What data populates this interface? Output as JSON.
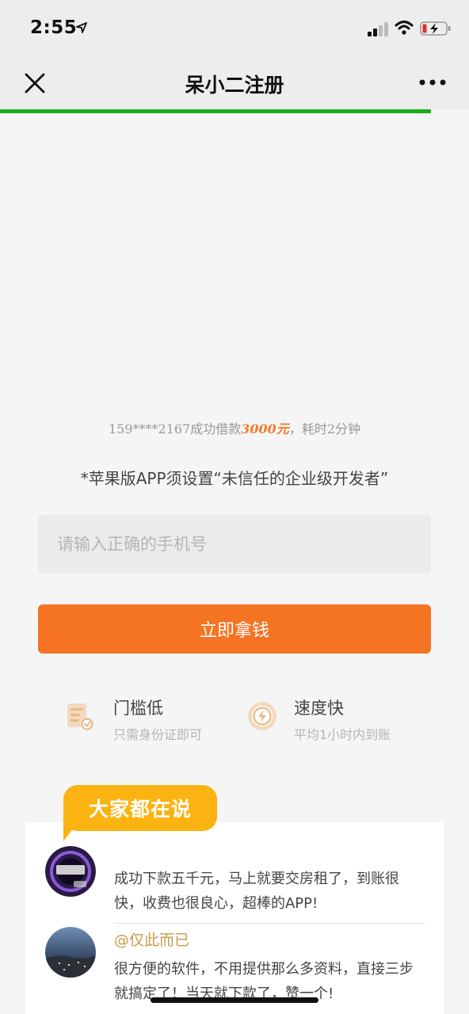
{
  "status": {
    "time": "2:55"
  },
  "nav": {
    "title": "呆小二注册"
  },
  "promo": {
    "prefix": "159****2167成功借款",
    "amount": "3000元",
    "suffix": "，耗时2分钟"
  },
  "notice": "*苹果版APP须设置“未信任的企业级开发者”",
  "phone_input": {
    "placeholder": "请输入正确的手机号"
  },
  "cta": {
    "label": "立即拿钱"
  },
  "features": [
    {
      "title": "门槛低",
      "subtitle": "只需身份证即可",
      "icon": "id-document-icon"
    },
    {
      "title": "速度快",
      "subtitle": "平均1小时内到账",
      "icon": "lightning-icon"
    }
  ],
  "reviews_badge": "大家都在说",
  "reviews": [
    {
      "name": "",
      "text": "成功下款五千元，马上就要交房租了，到账很快，收费也很良心，超棒的APP!"
    },
    {
      "name": "@仅此而已",
      "text": "很方便的软件，不用提供那么多资料，直接三步就搞定了！当天就下款了，赞一个!"
    }
  ],
  "colors": {
    "accent": "#f47424",
    "progress": "#1aad19",
    "badge": "#fbb311",
    "name": "#c89a4a"
  }
}
